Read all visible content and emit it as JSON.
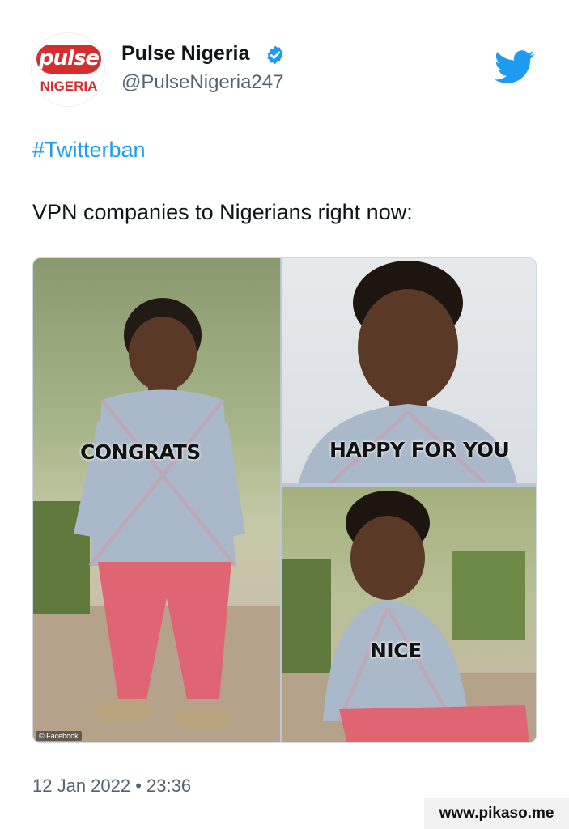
{
  "tweet": {
    "avatar_text": "pulse",
    "avatar_subtext": "NIGERIA",
    "display_name": "Pulse Nigeria",
    "handle": "@PulseNigeria247",
    "hashtag": "#Twitterban",
    "text": "VPN companies to Nigerians right now:",
    "timestamp": "12 Jan 2022 • 23:36"
  },
  "media": {
    "panels": [
      {
        "caption": "CONGRATS"
      },
      {
        "caption": "HAPPY FOR YOU"
      },
      {
        "caption": "NICE"
      }
    ],
    "credit": "© Facebook"
  },
  "watermark": "www.pikaso.me",
  "icons": {
    "verified": "verified-badge-icon",
    "brand": "twitter-bird-icon"
  },
  "colors": {
    "accent": "#1d9bf0",
    "brand_red": "#d42e2e",
    "secondary_text": "#536471"
  }
}
